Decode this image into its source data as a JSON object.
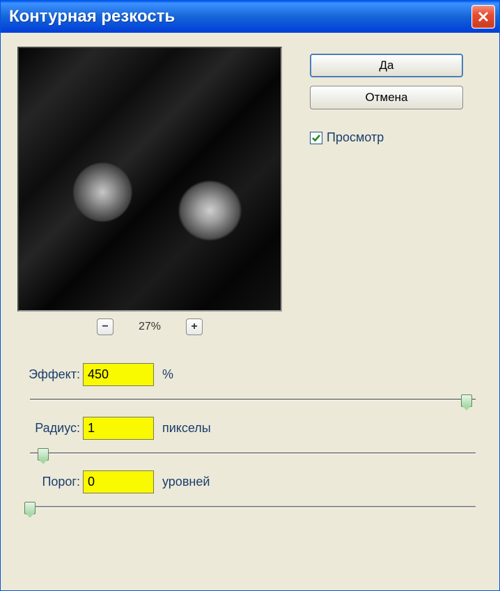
{
  "window": {
    "title": "Контурная резкость"
  },
  "buttons": {
    "ok": "Да",
    "cancel": "Отмена"
  },
  "preview": {
    "checkbox_label": "Просмотр",
    "checked": true
  },
  "zoom": {
    "level": "27%"
  },
  "sliders": {
    "effect": {
      "label": "Эффект:",
      "value": "450",
      "unit": "%",
      "position": 98
    },
    "radius": {
      "label": "Радиус:",
      "value": "1",
      "unit": "пикселы",
      "position": 3
    },
    "threshold": {
      "label": "Порог:",
      "value": "0",
      "unit": "уровней",
      "position": 0
    }
  }
}
